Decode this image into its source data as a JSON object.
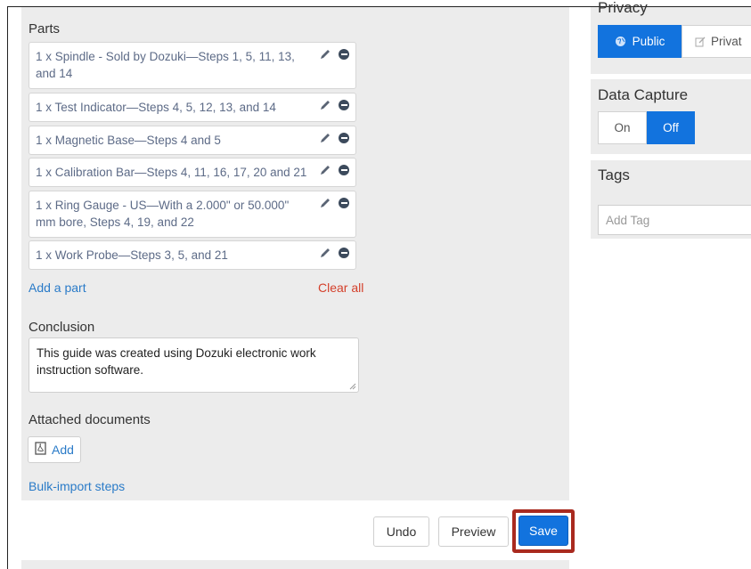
{
  "parts": {
    "heading": "Parts",
    "items": [
      {
        "text": "1 x Spindle - Sold by Dozuki—Steps 1, 5, 11, 13, and 14"
      },
      {
        "text": "1 x Test Indicator—Steps 4, 5, 12, 13, and 14"
      },
      {
        "text": "1 x Magnetic Base—Steps 4 and 5"
      },
      {
        "text": "1 x Calibration Bar—Steps 4, 11, 16, 17, 20 and 21"
      },
      {
        "text": "1 x Ring Gauge - US—With a 2.000\" or 50.000\" mm bore, Steps 4, 19, and 22"
      },
      {
        "text": "1 x Work Probe—Steps 3, 5, and 21"
      }
    ],
    "add_label": "Add a part",
    "clear_label": "Clear all"
  },
  "conclusion": {
    "heading": "Conclusion",
    "value": "This guide was created using Dozuki electronic work instruction software."
  },
  "attached": {
    "heading": "Attached documents",
    "add_label": "Add"
  },
  "bulk_import_label": "Bulk-import steps",
  "actions": {
    "undo": "Undo",
    "preview": "Preview",
    "save": "Save"
  },
  "privacy": {
    "heading": "Privacy",
    "public": "Public",
    "private": "Privat"
  },
  "data_capture": {
    "heading": "Data Capture",
    "on": "On",
    "off": "Off"
  },
  "tags": {
    "heading": "Tags",
    "placeholder": "Add Tag"
  },
  "colors": {
    "accent": "#1273de",
    "link": "#2a7bc8",
    "danger": "#d4402b",
    "highlight": "#a92a1f"
  }
}
